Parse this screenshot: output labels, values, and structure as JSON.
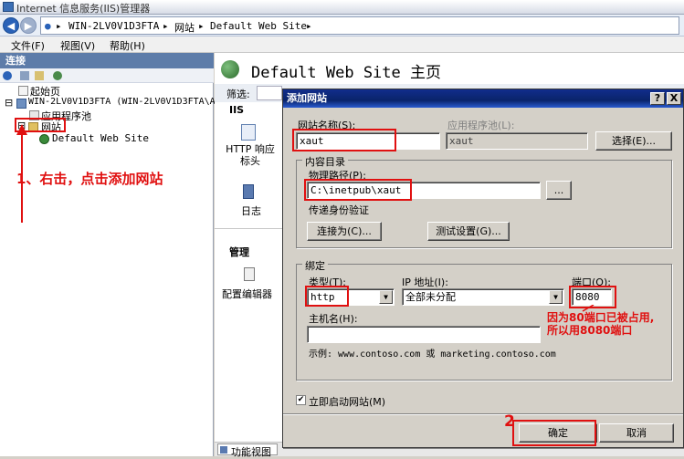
{
  "window": {
    "title": "Internet 信息服务(IIS)管理器"
  },
  "address": {
    "parts": [
      "WIN-2LV0V1D3FTA",
      "网站",
      "Default Web Site"
    ],
    "sep": "▸"
  },
  "menu": [
    "文件(F)",
    "视图(V)",
    "帮助(H)"
  ],
  "connections": {
    "header": "连接",
    "tree": [
      {
        "label": "起始页"
      },
      {
        "label": "WIN-2LV0V1D3FTA (WIN-2LV0V1D3FTA\\A"
      },
      {
        "label": "应用程序池"
      },
      {
        "label": "网站"
      },
      {
        "label": "Default Web Site"
      }
    ]
  },
  "main": {
    "title": "Default Web Site 主页",
    "filter_label": "筛选:",
    "iis_section": "IIS",
    "features": [
      "HTTP 响应标头",
      "日志"
    ],
    "manage_section": "管理",
    "config_editor": "配置编辑器",
    "view_tab": "功能视图"
  },
  "dialog": {
    "title": "添加网站",
    "help_btn": "?",
    "close_btn": "X",
    "site_name_label": "网站名称(S):",
    "site_name_value": "xaut",
    "app_pool_label": "应用程序池(L):",
    "app_pool_value": "xaut",
    "select_btn": "选择(E)...",
    "content_dir_label": "内容目录",
    "physical_path_label": "物理路径(P):",
    "physical_path_value": "C:\\inetpub\\xaut",
    "browse_btn": "...",
    "pass_auth_label": "传递身份验证",
    "connect_as_btn": "连接为(C)...",
    "test_settings_btn": "测试设置(G)...",
    "binding_label": "绑定",
    "type_label": "类型(T):",
    "type_value": "http",
    "ip_label": "IP 地址(I):",
    "ip_value": "全部未分配",
    "port_label": "端口(O):",
    "port_value": "8080",
    "host_label": "主机名(H):",
    "host_value": "",
    "example_text": "示例: www.contoso.com 或 marketing.contoso.com",
    "start_checkbox_label": "立即启动网站(M)",
    "start_checked": true,
    "ok_btn": "确定",
    "cancel_btn": "取消"
  },
  "annotations": {
    "step1": "1、右击，点击添加网站",
    "port_note_1": "因为80端口已被占用,",
    "port_note_2": "所以用8080端口",
    "step2": "2"
  },
  "colors": {
    "annotation": "#e01010",
    "dialog_title": "#0a246a",
    "panel_header": "#5d7ca9"
  }
}
